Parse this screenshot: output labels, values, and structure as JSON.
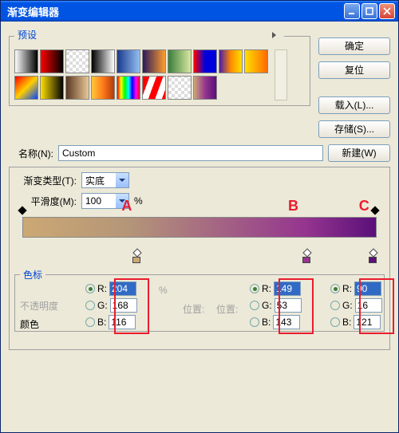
{
  "titlebar": {
    "title": "渐变编辑器"
  },
  "buttons": {
    "ok": "确定",
    "reset": "复位",
    "load": "载入(L)...",
    "save": "存储(S)...",
    "new": "新建(W)"
  },
  "presets": {
    "legend": "预设",
    "swatches": [
      "linear-gradient(to right,#fff,#000)",
      "linear-gradient(to right,#ff0000,#000)",
      "repeating-conic-gradient(#fff 0 25%,#ddd 0 50%) 0/8px 8px,linear-gradient(to right,#ff0000,transparent)",
      "linear-gradient(to right,#000,#fff)",
      "linear-gradient(to right,#1a3a8a,#93bff2)",
      "linear-gradient(to right,#2a1a5a,#ff9d2f)",
      "linear-gradient(to right,#3b7d3b,#d8e8a0)",
      "linear-gradient(to right,#ff0000,#00d,#00d)",
      "linear-gradient(to right,#4b1aaa,#ff8a00,#ffe000)",
      "linear-gradient(to right,#ffe000,#ff6a00)",
      "linear-gradient(to bottom right,#ff0000,#ffcf00,#0044ff)",
      "linear-gradient(to right,#ffe000,#000)",
      "linear-gradient(to right,#5a3820,#eac89a)",
      "linear-gradient(to right,#ffc83a,#ff7a1a,#b23a0a)",
      "linear-gradient(to right,#ff0000,#ffff00,#00ff00,#00ffff,#0000ff,#ff00ff,#ff0000)",
      "repeating-linear-gradient(110deg,#ff0000 0 8px,#fff 8px 16px)",
      "repeating-conic-gradient(#fff 0 25%,#ddd 0 50%) 0/8px 8px",
      "linear-gradient(to right,#cca874,#95358f,#5a1079)"
    ]
  },
  "name": {
    "label": "名称(N):",
    "value": "Custom"
  },
  "type": {
    "label": "渐变类型(T):",
    "value": "实底"
  },
  "smoothness": {
    "label": "平滑度(M):",
    "value": "100",
    "suffix": "%"
  },
  "stops_section": {
    "legend": "色标",
    "opacity_label": "不透明度",
    "position_label": "位置:",
    "color_label": "颜色"
  },
  "markers": {
    "a": "A",
    "b": "B",
    "c": "C"
  },
  "rgb": {
    "r_label": "R:",
    "g_label": "G:",
    "b_label": "B:",
    "a": {
      "r": "204",
      "g": "168",
      "b": "116"
    },
    "b": {
      "r": "149",
      "g": "53",
      "b": "143"
    },
    "c": {
      "r": "90",
      "g": "16",
      "b": "121"
    }
  }
}
